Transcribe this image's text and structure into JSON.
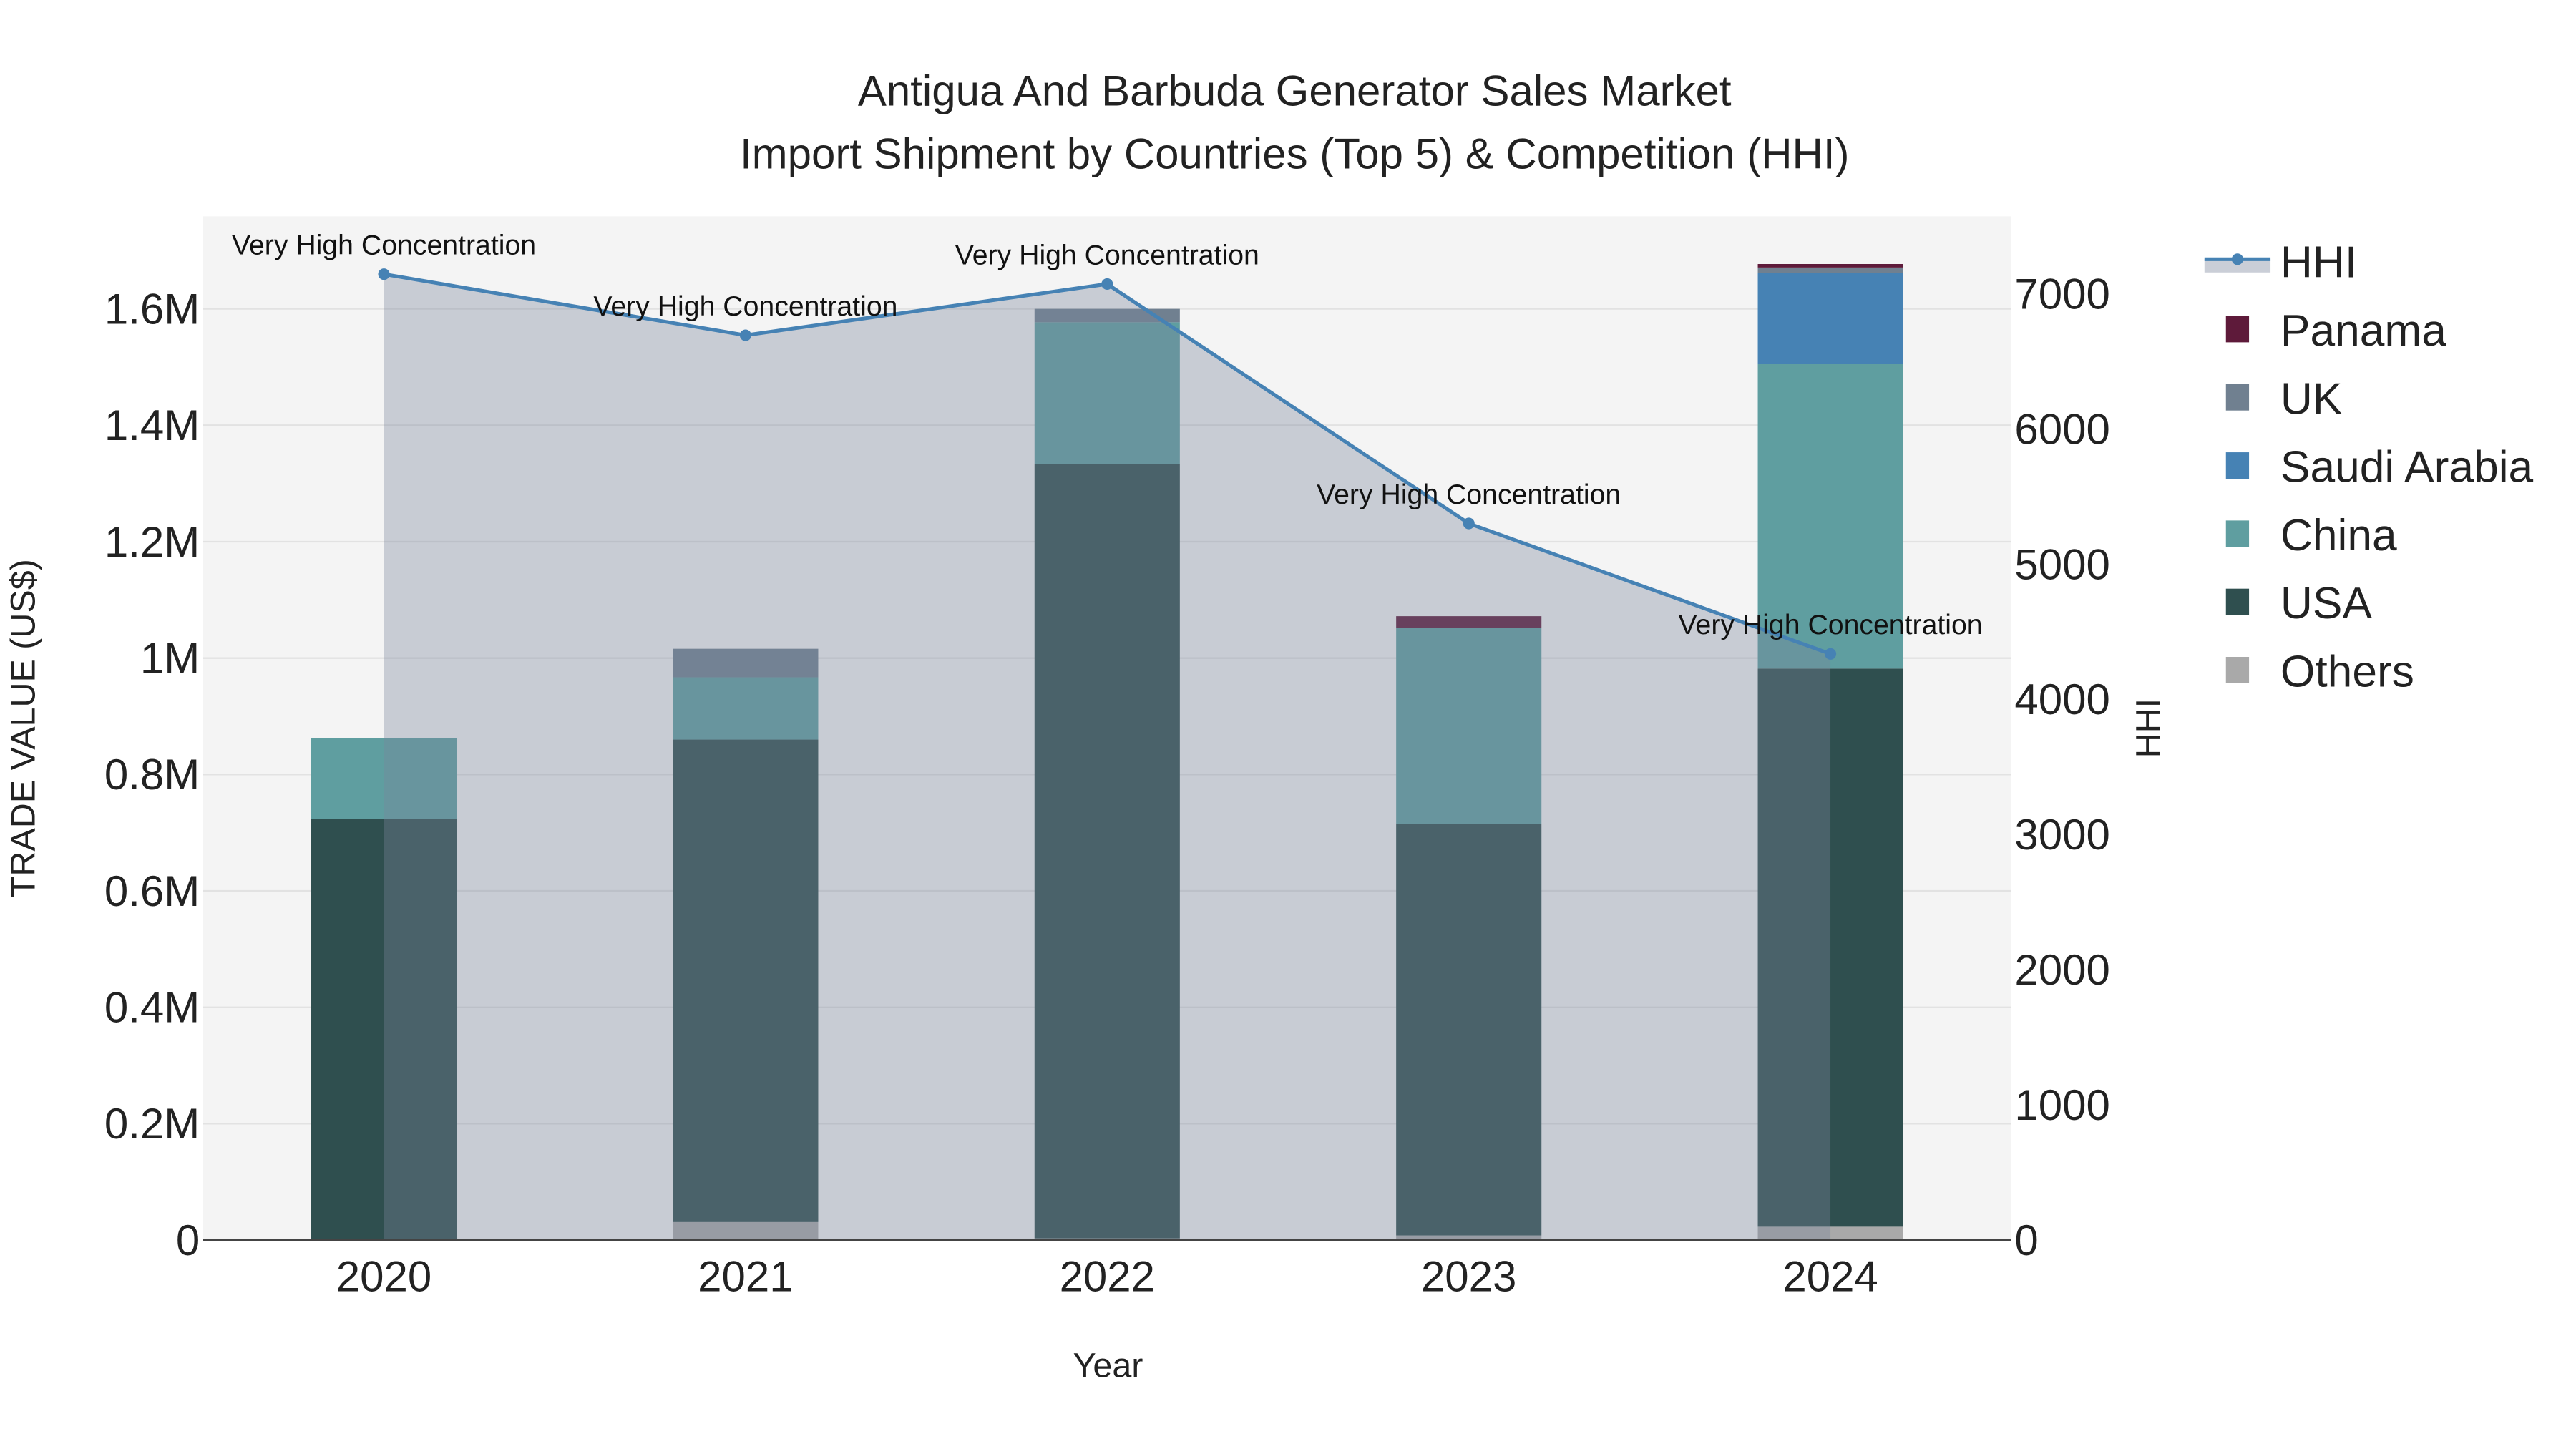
{
  "chart_data": {
    "type": "bar",
    "title_line1": "Antigua And Barbuda  Generator Sales Market",
    "title_line2": "Import Shipment by Countries (Top 5) & Competition (HHI)",
    "xlabel": "Year",
    "ylabel": "TRADE VALUE (US$)",
    "y2label": "HHI",
    "categories": [
      "2020",
      "2021",
      "2022",
      "2023",
      "2024"
    ],
    "ylim": [
      0,
      1759000
    ],
    "y2lim": [
      0,
      7574
    ],
    "yticks": [
      0,
      200000,
      400000,
      600000,
      800000,
      1000000,
      1200000,
      1400000,
      1600000
    ],
    "yticklabels": [
      "0",
      "0.2M",
      "0.4M",
      "0.6M",
      "0.8M",
      "1M",
      "1.2M",
      "1.4M",
      "1.6M"
    ],
    "y2ticks": [
      0,
      1000,
      2000,
      3000,
      4000,
      5000,
      6000,
      7000
    ],
    "y2ticklabels": [
      "0",
      "1000",
      "2000",
      "3000",
      "4000",
      "5000",
      "6000",
      "7000"
    ],
    "grid": true,
    "legend_position": "right",
    "series": [
      {
        "name": "Others",
        "color": "#a9a9a9",
        "values": [
          0,
          31000,
          3000,
          8000,
          23000
        ]
      },
      {
        "name": "USA",
        "color": "#2f4f4f",
        "values": [
          723000,
          829000,
          1330000,
          707000,
          959000
        ]
      },
      {
        "name": "China",
        "color": "#5f9ea0",
        "values": [
          139000,
          107000,
          244000,
          337000,
          524000
        ]
      },
      {
        "name": "Saudi Arabia",
        "color": "#4682b4",
        "values": [
          0,
          0,
          0,
          0,
          156000
        ]
      },
      {
        "name": "UK",
        "color": "#708090",
        "values": [
          0,
          49000,
          23000,
          0,
          9000
        ]
      },
      {
        "name": "Panama",
        "color": "#5e1a3a",
        "values": [
          0,
          0,
          0,
          20000,
          6000
        ]
      }
    ],
    "hhi": {
      "name": "HHI",
      "color": "#4682b4",
      "values": [
        7146,
        6694,
        7073,
        5302,
        4337
      ],
      "annotations": [
        "Very High Concentration",
        "Very High Concentration",
        "Very High Concentration",
        "Very High Concentration",
        "Very High Concentration"
      ]
    },
    "legend": [
      "HHI",
      "Panama",
      "UK",
      "Saudi Arabia",
      "China",
      "USA",
      "Others"
    ]
  }
}
